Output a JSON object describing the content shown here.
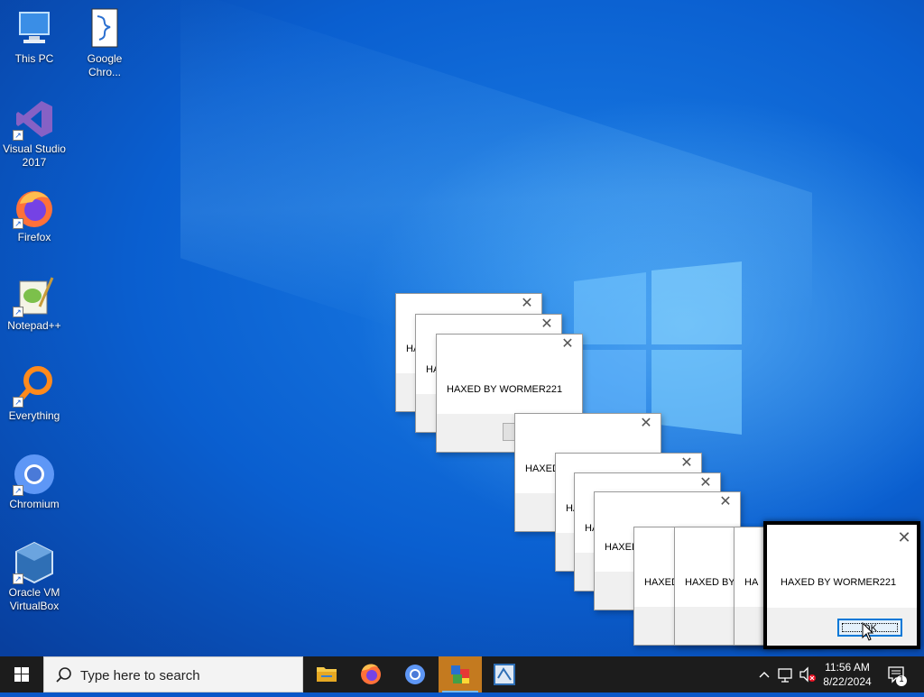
{
  "desktop": {
    "icons": [
      {
        "label": "This PC",
        "icon": "computer-icon"
      },
      {
        "label": "Google Chro...",
        "icon": "text-document-icon"
      },
      {
        "label": "Visual Studio 2017",
        "icon": "visual-studio-icon"
      },
      {
        "label": "Firefox",
        "icon": "firefox-icon"
      },
      {
        "label": "Notepad++",
        "icon": "notepad-plus-plus-icon"
      },
      {
        "label": "Everything",
        "icon": "everything-search-icon"
      },
      {
        "label": "Chromium",
        "icon": "chromium-icon"
      },
      {
        "label": "Oracle VM VirtualBox",
        "icon": "virtualbox-icon"
      }
    ]
  },
  "dialogs": {
    "message": "HAXED BY WORMER221",
    "message_cut_ha": "HA",
    "message_cut_haxed": "HAXED",
    "message_cut_haxed_by": "HAXED BY W",
    "ok_label": "OK"
  },
  "taskbar": {
    "search_placeholder": "Type here to search",
    "apps": [
      {
        "name": "file-explorer",
        "icon": "folder-icon"
      },
      {
        "name": "firefox",
        "icon": "firefox-icon"
      },
      {
        "name": "chromium",
        "icon": "chromium-icon"
      },
      {
        "name": "malware-app",
        "icon": "cubes-icon",
        "active": true
      },
      {
        "name": "virtualbox",
        "icon": "virtualbox-icon"
      }
    ],
    "clock_time": "11:56 AM",
    "clock_date": "8/22/2024",
    "notifications_count": "1"
  },
  "colors": {
    "wallpaper_blue": "#0a57c8",
    "taskbar": "#1c1c1c",
    "active_app": "#c47a1f",
    "focus_blue": "#0078d7"
  }
}
